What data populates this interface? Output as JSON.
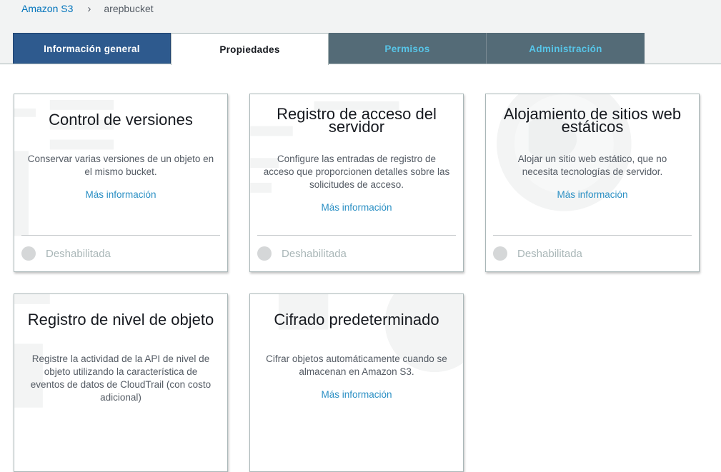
{
  "breadcrumb": {
    "root": "Amazon S3",
    "separator": "›",
    "current": "arepbucket"
  },
  "tabs": [
    {
      "label": "Información general",
      "state": "default"
    },
    {
      "label": "Propiedades",
      "state": "selected"
    },
    {
      "label": "Permisos",
      "state": "default"
    },
    {
      "label": "Administración",
      "state": "default"
    }
  ],
  "cards": [
    {
      "title": "Control de versiones",
      "description": "Conservar varias versiones de un objeto en el mismo bucket.",
      "link": "Más información",
      "status": "Deshabilitada"
    },
    {
      "title": "Registro de acceso del servidor",
      "description": "Configure las entradas de registro de acceso que proporcionen detalles sobre las solicitudes de acceso.",
      "link": "Más información",
      "status": "Deshabilitada"
    },
    {
      "title": "Alojamiento de sitios web estáticos",
      "description": "Alojar un sitio web estático, que no necesita tecnologías de servidor.",
      "link": "Más información",
      "status": "Deshabilitada"
    },
    {
      "title": "Registro de nivel de objeto",
      "description": "Registre la actividad de la API de nivel de objeto utilizando la característica de eventos de datos de CloudTrail (con costo adicional)",
      "link": "",
      "status": ""
    },
    {
      "title": "Cifrado predeterminado",
      "description": "Cifrar objetos automáticamente cuando se almacenan en Amazon S3.",
      "link": "Más información",
      "status": ""
    }
  ],
  "colors": {
    "tab_general_bg": "#2e5a8e",
    "tab_inactive_bg": "#546b77",
    "tab_inactive_text": "#57c5e8",
    "link": "#2a8fc4",
    "status_text": "#aab7b8"
  },
  "icons": [
    "chevron-right-icon",
    "status-dot-icon"
  ]
}
